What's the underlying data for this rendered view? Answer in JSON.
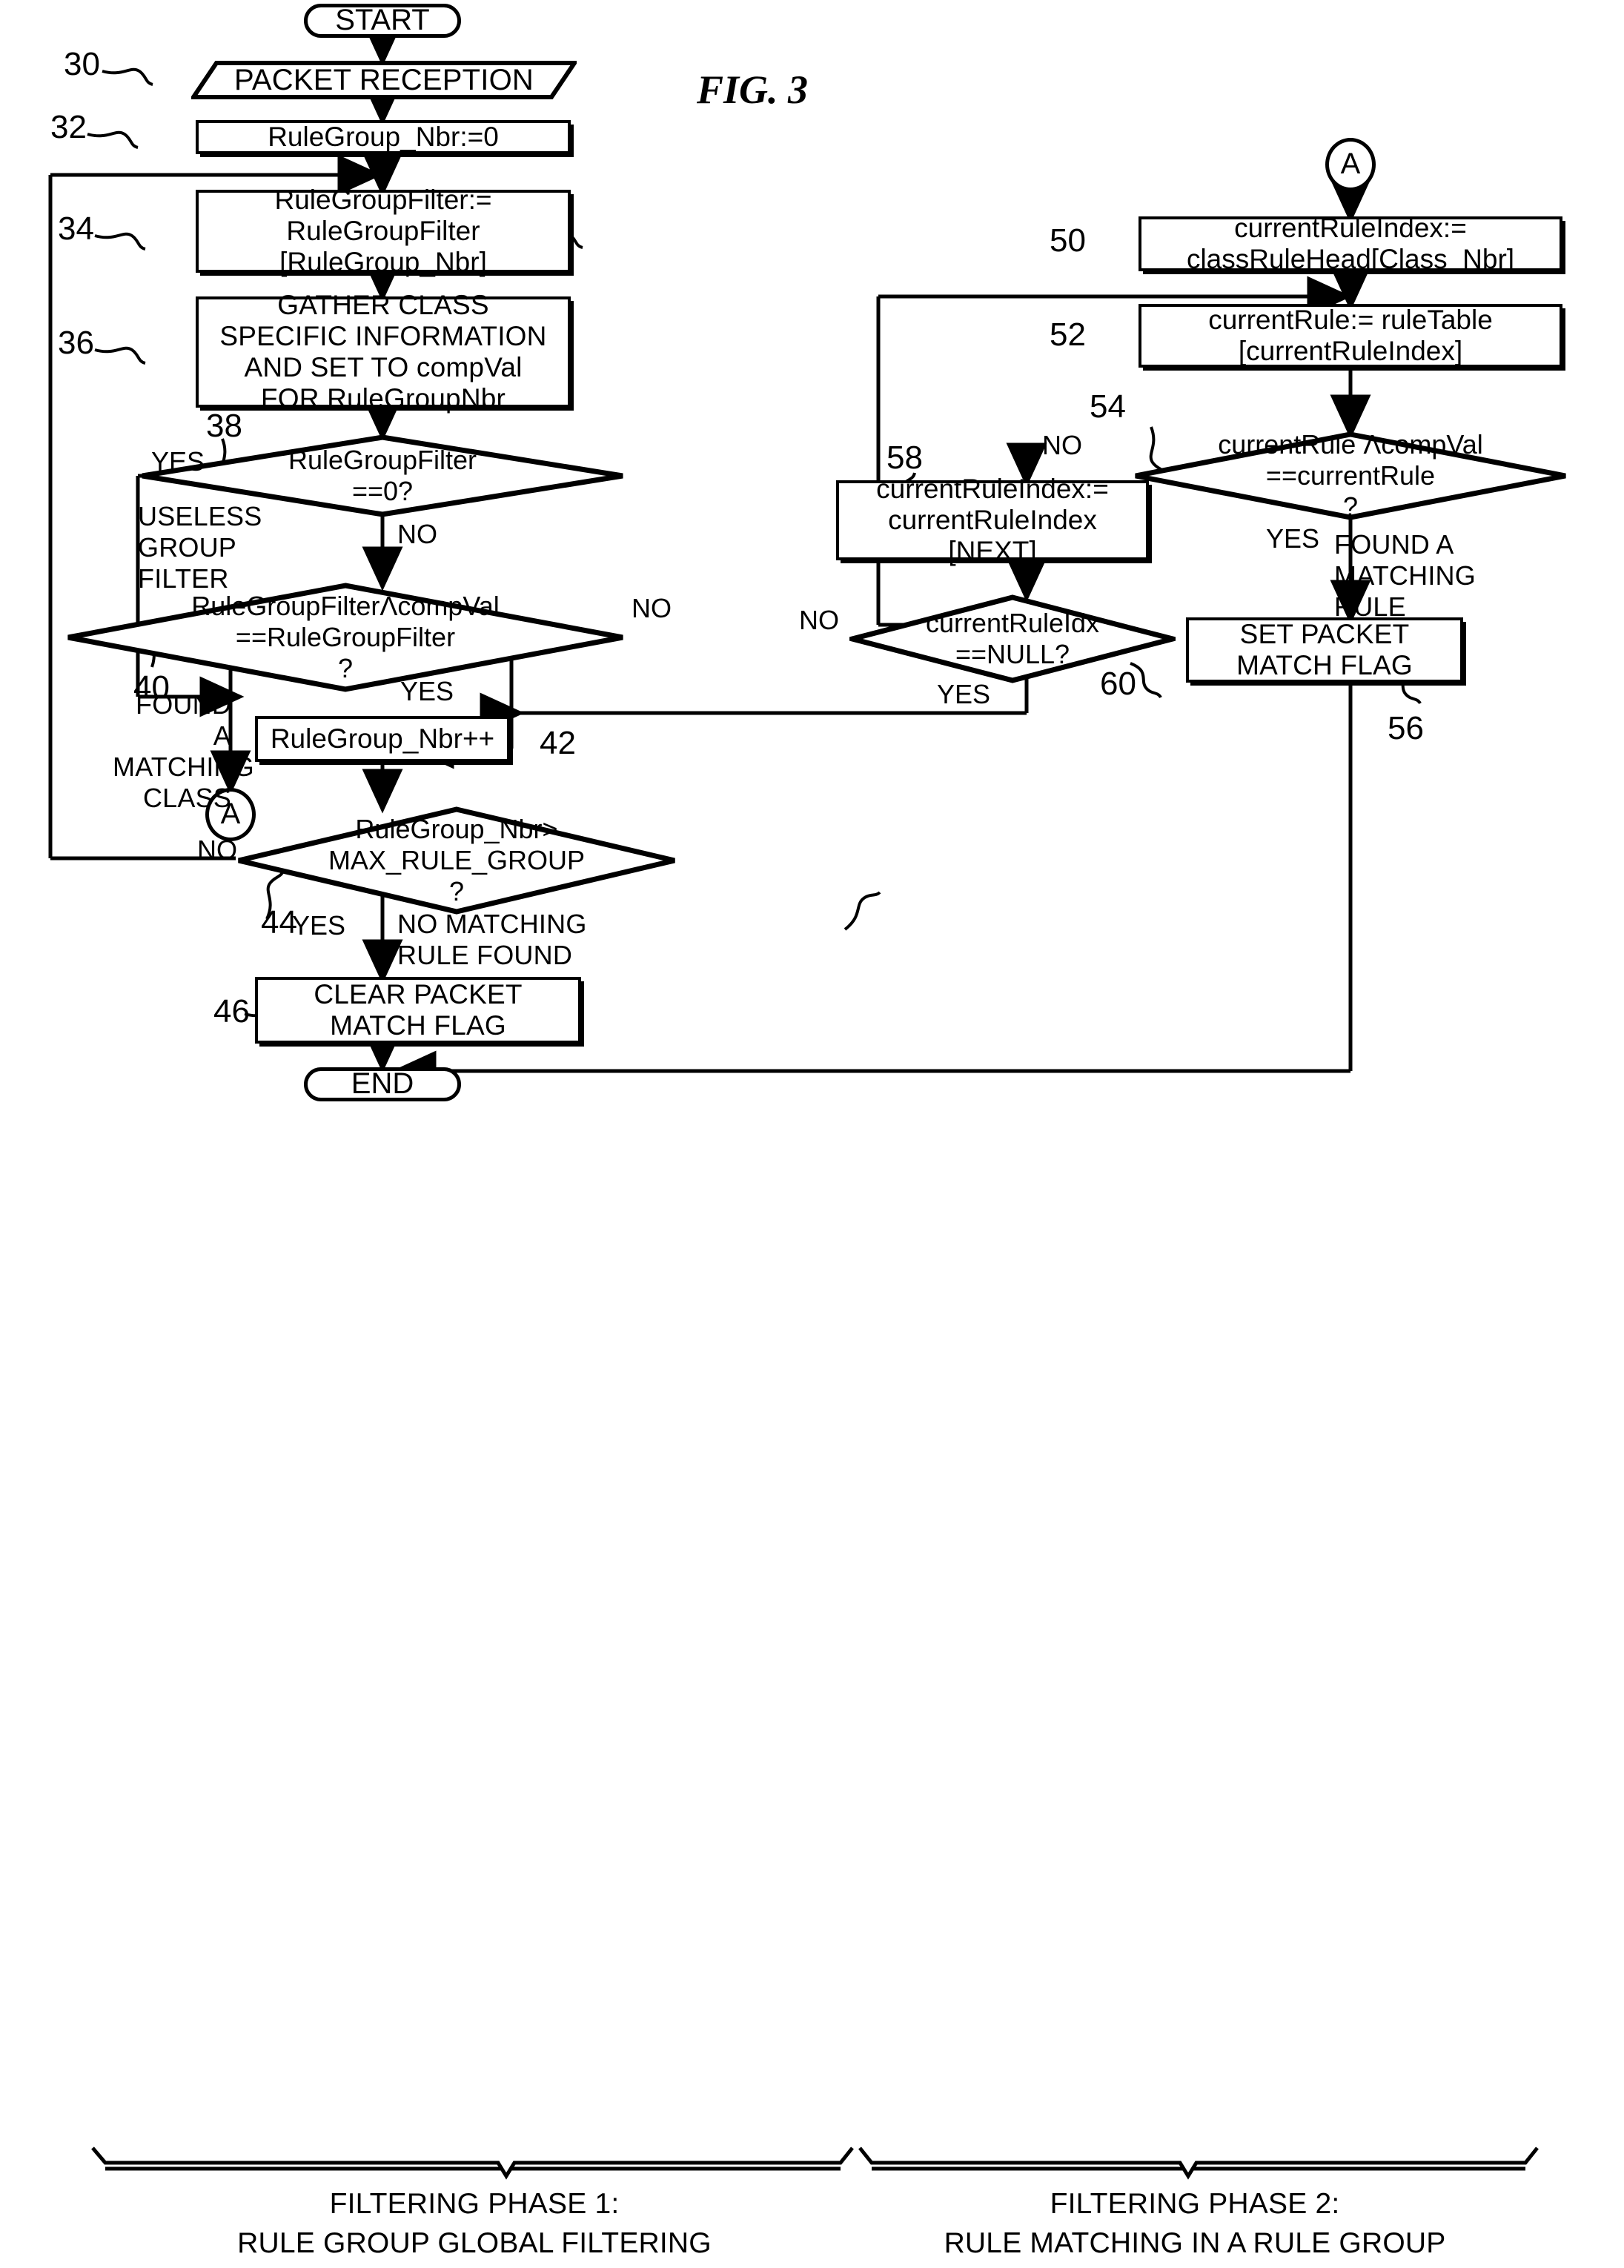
{
  "figure": {
    "title": "FIG. 3",
    "domain": "patent-flowchart"
  },
  "nodes": {
    "start": {
      "ref": "",
      "text": "START"
    },
    "packet_rec": {
      "ref": "30",
      "text": "PACKET RECEPTION"
    },
    "init_nbr": {
      "ref": "32",
      "text": "RuleGroup_Nbr:=0"
    },
    "load_filter": {
      "ref": "34",
      "line1": "RuleGroupFilter:=",
      "line2": "RuleGroupFilter",
      "line3": "[RuleGroup_Nbr]"
    },
    "gather": {
      "ref": "36",
      "line1": "GATHER CLASS",
      "line2": "SPECIFIC INFORMATION",
      "line3": "AND SET TO compVal",
      "line4": "FOR RuleGroupNbr"
    },
    "d_filter0": {
      "ref": "38",
      "line1": "RuleGroupFilter",
      "line2": "==0?"
    },
    "d_match": {
      "ref": "40",
      "line1": "RuleGroupFilterΛcompVal",
      "line2": "==RuleGroupFilter",
      "line3": "?"
    },
    "inc_nbr": {
      "ref": "42",
      "text": "RuleGroup_Nbr++"
    },
    "d_max": {
      "ref": "44",
      "line1": "RuleGroup_Nbr>",
      "line2": "MAX_RULE_GROUP",
      "line3": "?"
    },
    "clear_flag": {
      "ref": "46",
      "line1": "CLEAR PACKET",
      "line2": "MATCH FLAG"
    },
    "end": {
      "ref": "",
      "text": "END"
    },
    "conn_a_out": {
      "ref": "",
      "text": "A"
    },
    "conn_a_in": {
      "ref": "",
      "text": "A"
    },
    "rule_head": {
      "ref": "50",
      "line1": "currentRuleIndex:=",
      "line2": "classRuleHead[Class_Nbr]"
    },
    "cur_rule": {
      "ref": "52",
      "line1": "currentRule:= ruleTable",
      "line2": "[currentRuleIndex]"
    },
    "d_rulematch": {
      "ref": "54",
      "line1": "currentRule ΛcompVal",
      "line2": "==currentRule",
      "line3": "?"
    },
    "set_flag": {
      "ref": "56",
      "line1": "SET PACKET",
      "line2": "MATCH FLAG"
    },
    "next_idx": {
      "ref": "58",
      "line1": "currentRuleIndex:=",
      "line2": "currentRuleIndex",
      "line3": "[NEXT]"
    },
    "d_null": {
      "ref": "60",
      "line1": "currentRuleIdx",
      "line2": "==NULL?"
    }
  },
  "edge_labels": {
    "yes": "YES",
    "no": "NO",
    "useless_group_filter": {
      "l1": "USELESS",
      "l2": "GROUP",
      "l3": "FILTER"
    },
    "found_matching_class": {
      "l1": "FOUND A",
      "l2": "MATCHING",
      "l3": "CLASS"
    },
    "found_matching_rule": {
      "l1": "FOUND A",
      "l2": "MATCHING",
      "l3": "RULE"
    },
    "no_matching_rule": {
      "l1": "NO MATCHING",
      "l2": "RULE FOUND"
    }
  },
  "captions": {
    "phase1": {
      "l1": "FILTERING PHASE 1:",
      "l2": "RULE GROUP GLOBAL FILTERING"
    },
    "phase2": {
      "l1": "FILTERING PHASE 2:",
      "l2": "RULE MATCHING IN A RULE GROUP"
    }
  },
  "colors": {
    "ink": "#000000",
    "paper": "#ffffff"
  }
}
